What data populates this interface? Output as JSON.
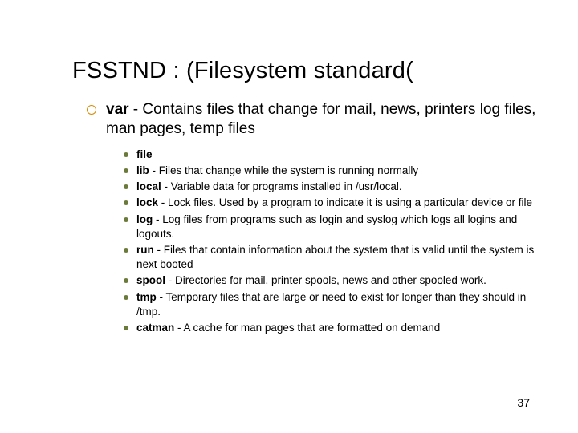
{
  "title": "FSSTND : (Filesystem standard(",
  "main": {
    "lead": "var",
    "rest": " - Contains files that change for mail, news, printers log files, man pages, temp files"
  },
  "items": [
    {
      "term": "file",
      "desc": ""
    },
    {
      "term": "lib",
      "desc": " - Files that change while the system is running normally"
    },
    {
      "term": "local",
      "desc": " - Variable data for programs installed in /usr/local."
    },
    {
      "term": "lock",
      "desc": " - Lock files. Used by a program to indicate it is using a particular device or file"
    },
    {
      "term": "log",
      "desc": " - Log files from programs such as login and syslog which logs all logins and logouts."
    },
    {
      "term": "run",
      "desc": " - Files that contain information about the system that is valid until the system is next booted"
    },
    {
      "term": "spool",
      "desc": " - Directories for mail, printer spools, news and other spooled work."
    },
    {
      "term": "tmp",
      "desc": " - Temporary files that are large or need to exist for longer than they should in /tmp."
    },
    {
      "term": "catman",
      "desc": " - A cache for man pages that are formatted on demand"
    }
  ],
  "page_number": "37"
}
